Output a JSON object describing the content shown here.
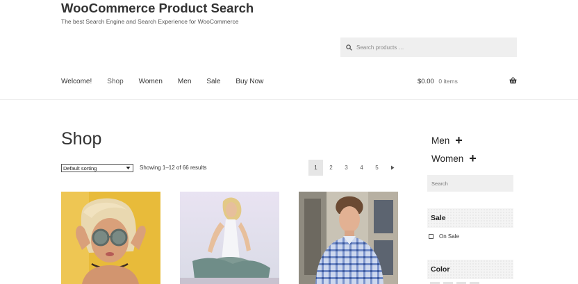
{
  "header": {
    "title": "WooCommerce Product Search",
    "tagline": "The best Search Engine and Search Experience for WooCommerce",
    "search_placeholder": "Search products …"
  },
  "nav": {
    "items": [
      {
        "label": "Welcome!"
      },
      {
        "label": "Shop"
      },
      {
        "label": "Women"
      },
      {
        "label": "Men"
      },
      {
        "label": "Sale"
      },
      {
        "label": "Buy Now"
      }
    ],
    "active": "Shop"
  },
  "cart": {
    "total": "$0.00",
    "count": "0 items"
  },
  "main": {
    "title": "Shop",
    "sort_selected": "Default sorting",
    "result_count": "Showing 1–12 of 66 results",
    "pagination": [
      "1",
      "2",
      "3",
      "4",
      "5"
    ],
    "current_page": "1",
    "products": [
      {
        "image": "woman-with-round-sunglasses-photo"
      },
      {
        "image": "woman-in-white-top-photo"
      },
      {
        "image": "man-in-plaid-shirt-photo"
      }
    ]
  },
  "sidebar": {
    "categories": [
      {
        "label": "Men",
        "toggle": "+"
      },
      {
        "label": "Women",
        "toggle": "+"
      }
    ],
    "search_placeholder": "Search",
    "sale_heading": "Sale",
    "on_sale_label": "On Sale",
    "color_heading": "Color"
  },
  "colors": {
    "accent": "#333333",
    "muted_bg": "#efefef",
    "current_page_bg": "#e6e6e6"
  }
}
